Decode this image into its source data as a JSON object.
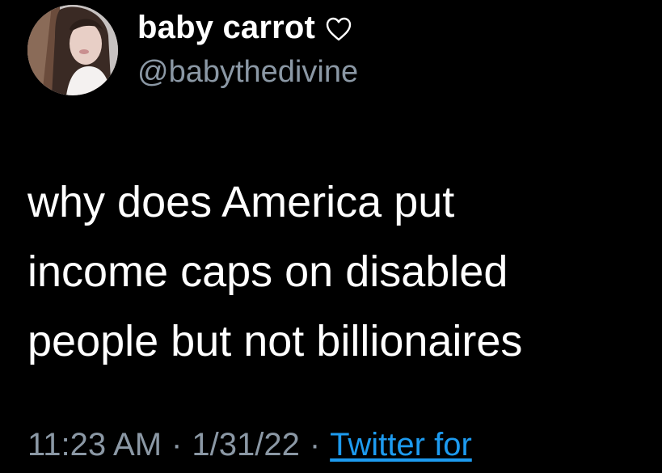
{
  "user": {
    "display_name": "baby carrot",
    "handle": "@babythedivine",
    "name_emoji_icon": "white-heart-icon"
  },
  "tweet": {
    "text": "why does America put\nincome caps on disabled\npeople but not billionaires"
  },
  "meta": {
    "time": "11:23 AM",
    "separator_1": "·",
    "date": "1/31/22",
    "separator_2": "·",
    "source": "Twitter for"
  },
  "colors": {
    "background": "#000000",
    "text_primary": "#ffffff",
    "text_secondary": "#8b98a5",
    "link": "#1d9bf0"
  }
}
